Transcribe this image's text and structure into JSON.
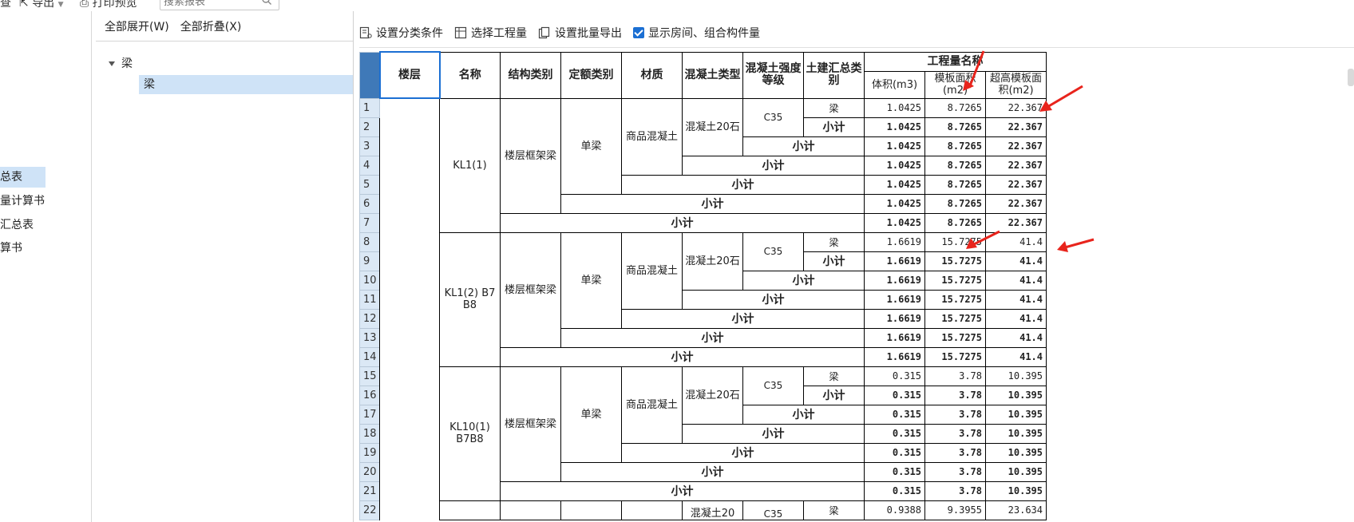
{
  "toolbar": {
    "item1": "查",
    "export_label": "导出",
    "print_preview_label": "打印预览",
    "search_placeholder": "搜索报表"
  },
  "left_panel": {
    "items": [
      "总表",
      "量计算书",
      "汇总表",
      "算书"
    ]
  },
  "tree": {
    "expand_all": "全部展开(W)",
    "collapse_all": "全部折叠(X)",
    "root": "梁",
    "child": "梁"
  },
  "report_toolbar": {
    "set_category": "设置分类条件",
    "select_quantity": "选择工程量",
    "batch_export": "设置批量导出",
    "show_rooms": "显示房间、组合构件量",
    "show_rooms_checked": true
  },
  "table": {
    "headers": {
      "floor": "楼层",
      "name": "名称",
      "struct_type": "结构类别",
      "quota_type": "定额类别",
      "material": "材质",
      "concrete_type": "混凝土类型",
      "concrete_grade": "混凝土强度等级",
      "civil_category": "土建汇总类别",
      "quantity_name": "工程量名称",
      "volume": "体积(m3)",
      "formwork_area": "模板面积(m2)",
      "high_formwork_area": "超高模板面积(m2)"
    },
    "groups": [
      {
        "name": "KL1(1)",
        "struct_type": "楼层框架梁",
        "quota_type": "单梁",
        "material": "商品混凝土",
        "concrete_type": "混凝土20石",
        "grade": "C35",
        "category": "梁",
        "subtotal": "小计",
        "values": [
          "1.0425",
          "8.7265",
          "22.367"
        ]
      },
      {
        "name": "KL1(2) B7 B8",
        "struct_type": "楼层框架梁",
        "quota_type": "单梁",
        "material": "商品混凝土",
        "concrete_type": "混凝土20石",
        "grade": "C35",
        "category": "梁",
        "subtotal": "小计",
        "values": [
          "1.6619",
          "15.7275",
          "41.4"
        ]
      },
      {
        "name": "KL10(1) B7B8",
        "struct_type": "楼层框架梁",
        "quota_type": "单梁",
        "material": "商品混凝土",
        "concrete_type": "混凝土20石",
        "grade": "C35",
        "category": "梁",
        "subtotal": "小计",
        "values": [
          "0.315",
          "3.78",
          "10.395"
        ]
      }
    ],
    "last_row": {
      "row_no": "22",
      "concrete_type": "混凝土20",
      "grade": "C35",
      "category": "梁",
      "values": [
        "0.9388",
        "9.3955",
        "23.634"
      ]
    }
  },
  "colors": {
    "accent": "#1b6fd3",
    "selection": "#cfe3f7",
    "arrow": "#e8241c"
  }
}
